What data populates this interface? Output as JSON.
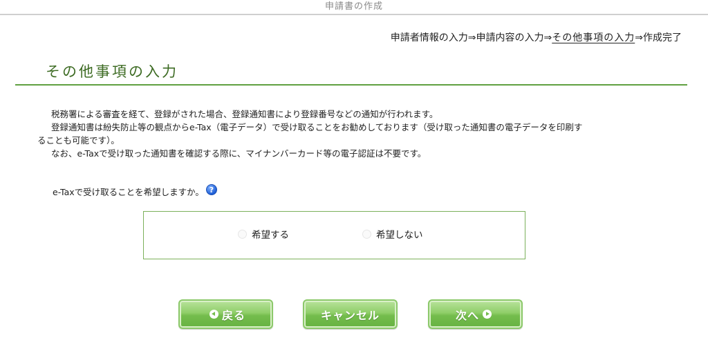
{
  "header": {
    "title": "申請書の作成"
  },
  "steps": {
    "step1": "申請者情報の入力",
    "arrow1": "⇒",
    "step2": "申請内容の入力",
    "arrow2": "⇒",
    "step3_current": "その他事項の入力",
    "arrow3": "⇒",
    "step4": "作成完了"
  },
  "section": {
    "title": "その他事項の入力"
  },
  "description": {
    "line1": "税務署による審査を経て、登録がされた場合、登録通知書により登録番号などの通知が行われます。",
    "line2": "登録通知書は紛失防止等の観点からe-Tax（電子データ）で受け取ることをお勧めしております（受け取った通知書の電子データを印刷す",
    "line2_cont": "ることも可能です）。",
    "line3": "なお、e-Taxで受け取った通知書を確認する際に、マイナンバーカード等の電子認証は不要です。"
  },
  "question": {
    "text": "e-Taxで受け取ることを希望しますか。",
    "help_icon": "?"
  },
  "options": {
    "yes_label": "希望する",
    "no_label": "希望しない"
  },
  "buttons": {
    "back": "戻る",
    "cancel": "キャンセル",
    "next": "次へ"
  },
  "colors": {
    "accent_green": "#5fa040",
    "title_green": "#3d6b23",
    "help_blue": "#1f5fd6"
  }
}
